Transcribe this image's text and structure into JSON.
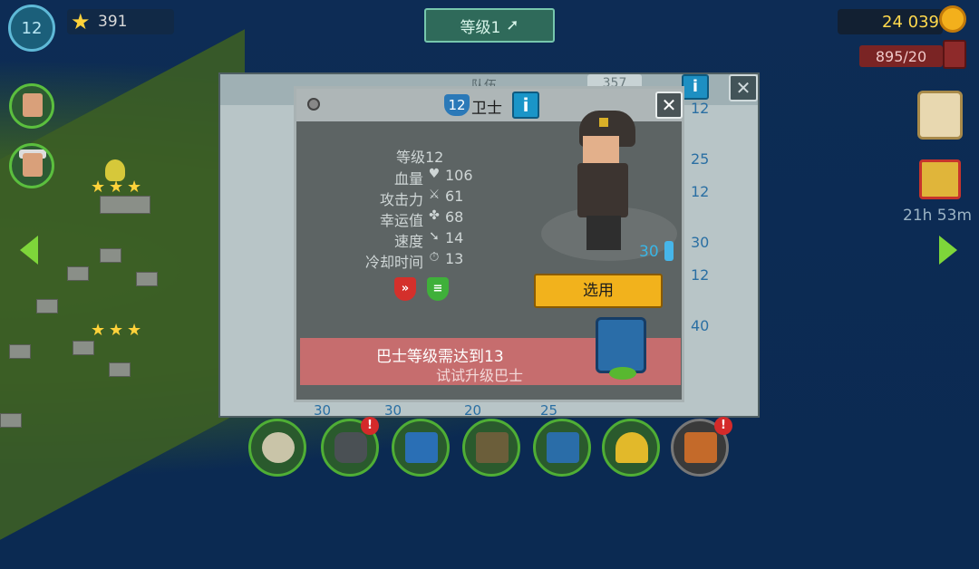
{
  "hud": {
    "player_level": "12",
    "stars": "391",
    "rank_button": "等级1",
    "coins": "24 039",
    "fuel": "895/20",
    "timer": "21h 53m"
  },
  "back_panel": {
    "title": "队伍",
    "count": "357",
    "side_numbers": [
      "12",
      "25",
      "12",
      "30",
      "12",
      "40"
    ],
    "bottom_numbers": [
      "30",
      "30",
      "20",
      "25"
    ]
  },
  "modal": {
    "level_badge": "12",
    "name": "卫士",
    "info": "i",
    "close": "✕",
    "level_text": "等级12",
    "stats": [
      {
        "label": "血量",
        "icon": "heart-icon",
        "glyph": "♥",
        "value": "106"
      },
      {
        "label": "攻击力",
        "icon": "sword-icon",
        "glyph": "⚔",
        "value": "61"
      },
      {
        "label": "幸运值",
        "icon": "clover-icon",
        "glyph": "✤",
        "value": "68"
      },
      {
        "label": "速度",
        "icon": "boot-icon",
        "glyph": "➘",
        "value": "14"
      },
      {
        "label": "冷却时间",
        "icon": "stopwatch-icon",
        "glyph": "⏱",
        "value": "13"
      }
    ],
    "ammo": "30",
    "select_button": "选用",
    "warning_line1": "巴士等级需达到13",
    "warning_line2": "试试升级巴士"
  },
  "colors": {
    "select_button": "#f2b21c",
    "warning_bg": "#c66d6e",
    "info_button": "#1a95c8",
    "coin_text": "#ffd94d"
  }
}
